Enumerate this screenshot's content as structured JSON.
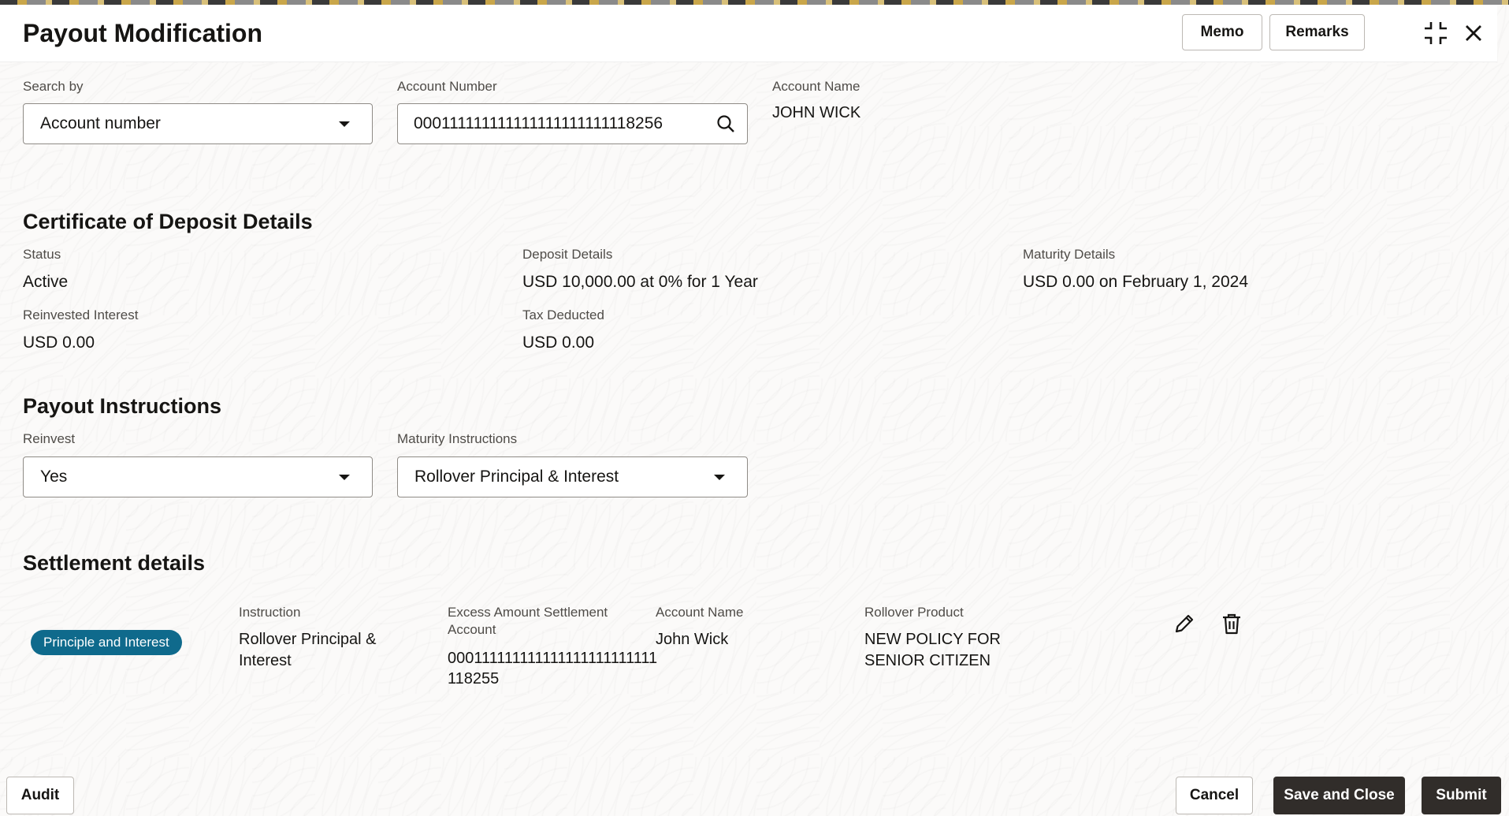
{
  "header": {
    "title": "Payout Modification",
    "memo_label": "Memo",
    "remarks_label": "Remarks"
  },
  "search": {
    "search_by_label": "Search by",
    "search_by_value": "Account number",
    "account_number_label": "Account Number",
    "account_number_value": "000111111111111111111111118256",
    "account_name_label": "Account Name",
    "account_name_value": "JOHN WICK"
  },
  "cd_details": {
    "title": "Certificate of Deposit Details",
    "status_label": "Status",
    "status_value": "Active",
    "deposit_label": "Deposit Details",
    "deposit_value": "USD 10,000.00 at 0% for 1 Year",
    "maturity_label": "Maturity Details",
    "maturity_value": "USD 0.00 on February 1, 2024",
    "reinvested_label": "Reinvested Interest",
    "reinvested_value": "USD 0.00",
    "tax_label": "Tax Deducted",
    "tax_value": "USD 0.00"
  },
  "payout": {
    "title": "Payout Instructions",
    "reinvest_label": "Reinvest",
    "reinvest_value": "Yes",
    "maturity_instr_label": "Maturity Instructions",
    "maturity_instr_value": "Rollover Principal & Interest"
  },
  "settlement": {
    "title": "Settlement details",
    "badge": "Principle and Interest",
    "instruction_label": "Instruction",
    "instruction_line1": "Rollover Principal &",
    "instruction_line2": "Interest",
    "excess_label_line1": "Excess Amount Settlement",
    "excess_label_line2": "Account",
    "excess_value_line1": "000111111111111111111111111",
    "excess_value_line2": "118255",
    "account_name_label": "Account Name",
    "account_name_value": "John Wick",
    "rollover_label": "Rollover Product",
    "rollover_line1": "NEW POLICY FOR",
    "rollover_line2": "SENIOR CITIZEN"
  },
  "footer": {
    "audit_label": "Audit",
    "cancel_label": "Cancel",
    "save_close_label": "Save and Close",
    "submit_label": "Submit"
  },
  "icons": {
    "search": "search-icon",
    "collapse": "collapse-icon",
    "close": "close-icon",
    "edit": "pencil-icon",
    "delete": "trash-icon"
  },
  "colors": {
    "badge": "#0f6a8c",
    "primary_button": "#312d2a"
  }
}
